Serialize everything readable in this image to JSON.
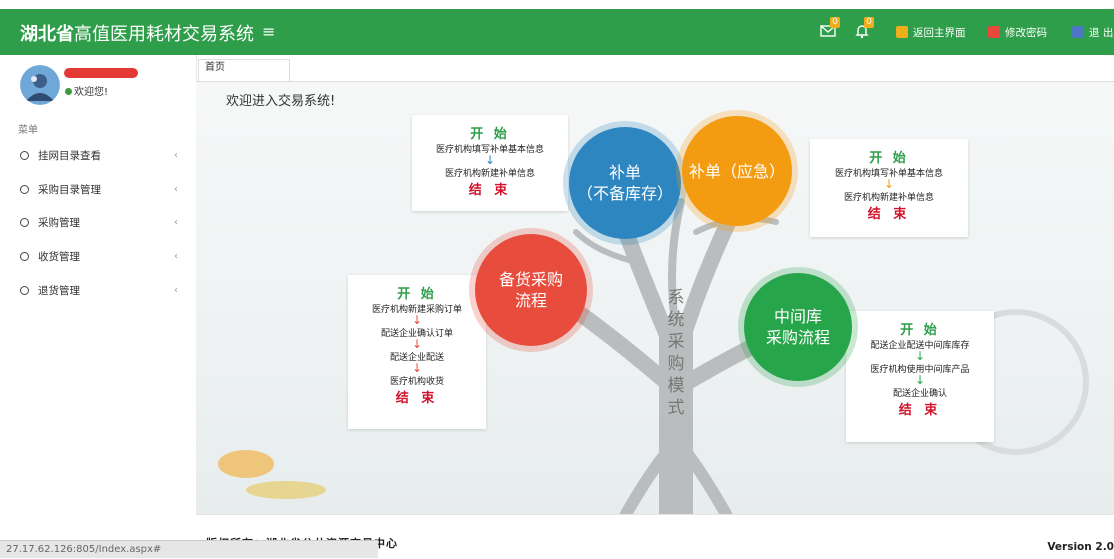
{
  "header": {
    "brand_bold": "湖北省",
    "brand_rest": "高值医用耗材交易系统",
    "menu_toggle": "≡",
    "mail_badge": "0",
    "bell_badge": "0",
    "buttons": [
      {
        "label": "返回主界面",
        "color": "#f0ad1e"
      },
      {
        "label": "修改密码",
        "color": "#e8493c"
      },
      {
        "label": "退 出",
        "color": "#4a78c2"
      }
    ]
  },
  "sidebar": {
    "welcome": "欢迎您!",
    "menu_label": "菜单",
    "items": [
      {
        "label": "挂网目录查看",
        "chevron": "‹"
      },
      {
        "label": "采购目录管理",
        "chevron": "‹"
      },
      {
        "label": "采购管理",
        "chevron": "‹"
      },
      {
        "label": "收货管理",
        "chevron": "‹"
      },
      {
        "label": "退货管理",
        "chevron": "‹"
      }
    ]
  },
  "tabs": [
    {
      "label": "首页"
    }
  ],
  "main": {
    "greeting": "欢迎进入交易系统!",
    "center_text": [
      "系",
      "统",
      "采",
      "购",
      "模",
      "式"
    ],
    "circles": {
      "supplement": [
        "补单",
        "（不备库存）"
      ],
      "emergency": [
        "补单（应急）"
      ],
      "stock": [
        "备货采购",
        "流程"
      ],
      "middle": [
        "中间库",
        "采购流程"
      ]
    },
    "cards": {
      "supplement": {
        "start": "开 始",
        "steps": [
          "医疗机构填写补单基本信息",
          "医疗机构新建补单信息"
        ],
        "end": "结 束"
      },
      "emergency": {
        "start": "开 始",
        "steps": [
          "医疗机构填写补单基本信息",
          "医疗机构新建补单信息"
        ],
        "end": "结 束"
      },
      "stock": {
        "start": "开 始",
        "steps": [
          "医疗机构新建采购订单",
          "配送企业确认订单",
          "配送企业配送",
          "医疗机构收货"
        ],
        "end": "结 束"
      },
      "middle": {
        "start": "开 始",
        "steps": [
          "配送企业配送中间库库存",
          "医疗机构使用中间库产品",
          "配送企业确认"
        ],
        "end": "结 束"
      }
    },
    "arrow": "↓",
    "colors": {
      "blue": "#2e86c1",
      "orange": "#f39c12",
      "red": "#e74c3c",
      "green": "#27a54a"
    }
  },
  "footer": {
    "copyright": "版权所有：湖北省公共资源交易中心",
    "version": "Version 2.0"
  },
  "statusbar": {
    "url": "27.17.62.126:805/Index.aspx#"
  }
}
